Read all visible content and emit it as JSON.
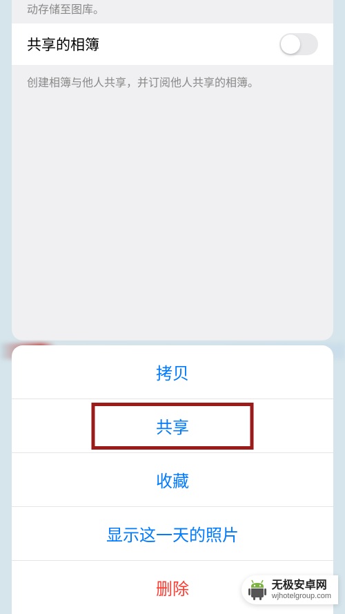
{
  "settings": {
    "truncated_hint": "动存储至图库。",
    "shared_album_label": "共享的相簿",
    "shared_album_description": "创建相簿与他人共享，并订阅他人共享的相簿。",
    "toggle_on": false
  },
  "action_sheet": {
    "items": [
      {
        "label": "拷贝",
        "destructive": false,
        "highlighted": false
      },
      {
        "label": "共享",
        "destructive": false,
        "highlighted": true
      },
      {
        "label": "收藏",
        "destructive": false,
        "highlighted": false
      },
      {
        "label": "显示这一天的照片",
        "destructive": false,
        "highlighted": false
      },
      {
        "label": "删除",
        "destructive": true,
        "highlighted": false
      }
    ]
  },
  "watermark": {
    "title": "无极安卓网",
    "url": "wjhotelgroup.com"
  },
  "colors": {
    "ios_blue": "#007aff",
    "ios_red": "#ff3b30",
    "highlight_border": "#9a1b1a",
    "brand_green": "#7cb342"
  }
}
